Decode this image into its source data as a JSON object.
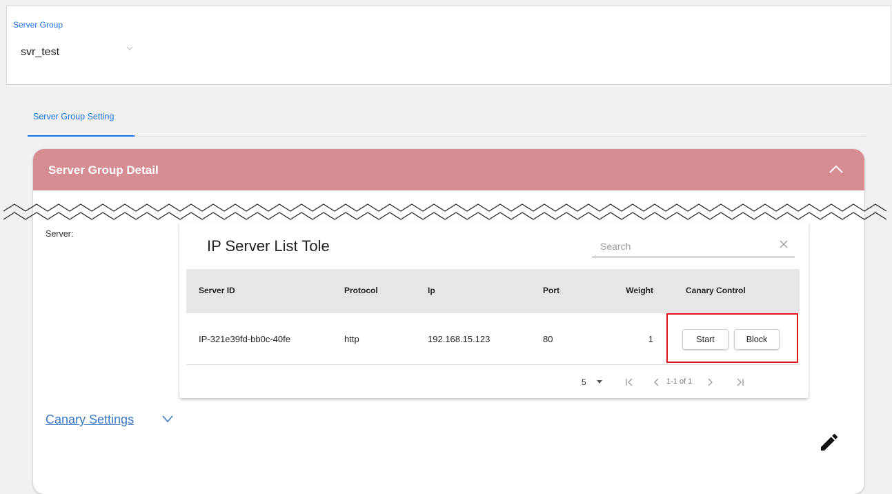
{
  "server_group": {
    "label": "Server Group",
    "selected": "svr_test"
  },
  "tabs": [
    {
      "label": "Server Group Setting",
      "active": true
    }
  ],
  "detail_card": {
    "title": "Server Group Detail",
    "header_color": "#d58d93",
    "server_label": "Server:",
    "canary_settings_label": "Canary Settings"
  },
  "table": {
    "title": "IP Server List Tole",
    "search_placeholder": "Search",
    "columns": [
      "Server ID",
      "Protocol",
      "Ip",
      "Port",
      "Weight",
      "Canary Control"
    ],
    "rows": [
      {
        "server_id": "IP-321e39fd-bb0c-40fe",
        "protocol": "http",
        "ip": "192.168.15.123",
        "port": "80",
        "weight": "1"
      }
    ],
    "actions": {
      "start": "Start",
      "block": "Block"
    },
    "highlight_color": "#e0141b",
    "pagination": {
      "rows_per_page": "5",
      "range": "1-1 of 1"
    }
  },
  "icons": [
    "chevron-down-icon",
    "chevron-up-icon",
    "close-icon",
    "dropdown-arrow-icon",
    "first-page-icon",
    "prev-page-icon",
    "next-page-icon",
    "last-page-icon",
    "pencil-icon"
  ]
}
